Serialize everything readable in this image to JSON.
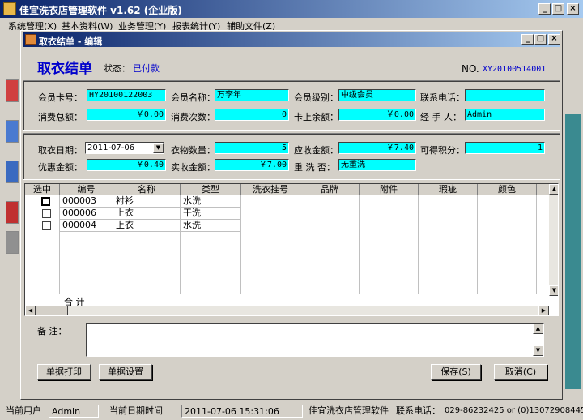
{
  "window": {
    "title": "佳宜洗衣店管理软件 v1.62 (企业版)",
    "minimize": "_",
    "restore": "□",
    "close": "×"
  },
  "menu": [
    "系统管理(X)",
    "基本资料(W)",
    "业务管理(Y)",
    "报表统计(Y)",
    "辅助文件(Z)"
  ],
  "dialog": {
    "title": "取衣结单 - 编辑",
    "minimize": "_",
    "restore": "□",
    "close": "×"
  },
  "form": {
    "title": "取衣结单",
    "status_label": "状态：",
    "status_value": "已付款",
    "no_label": "NO.",
    "no_value": "XY20100514001"
  },
  "member": {
    "card_label": "会员卡号：",
    "card_value": "HY20100122003",
    "name_label": "会员名称：",
    "name_value": "万李年",
    "level_label": "会员级别：",
    "level_value": "中级会员",
    "phone_label": "联系电话：",
    "phone_value": "",
    "total_label": "消费总额：",
    "total_value": "￥0.00",
    "count_label": "消费次数：",
    "count_value": "0",
    "balance_label": "卡上余额：",
    "balance_value": "￥0.00",
    "operator_label": "经 手 人：",
    "operator_value": "Admin"
  },
  "order": {
    "date_label": "取衣日期：",
    "date_value": "2011-07-06",
    "qty_label": "衣物数量：",
    "qty_value": "5",
    "due_label": "应收金额：",
    "due_value": "￥7.40",
    "points_label": "可得积分：",
    "points_value": "1",
    "discount_label": "优惠金额：",
    "discount_value": "￥0.40",
    "paid_label": "实收金额：",
    "paid_value": "￥7.00",
    "rewash_label": "重 洗 否：",
    "rewash_value": "无重洗"
  },
  "grid": {
    "columns": [
      "选中",
      "编号",
      "名称",
      "类型",
      "洗衣挂号",
      "品牌",
      "附件",
      "瑕疵",
      "颜色"
    ],
    "rows": [
      {
        "id": "000003",
        "name": "衬衫",
        "type": "水洗"
      },
      {
        "id": "000006",
        "name": "上衣",
        "type": "干洗"
      },
      {
        "id": "000004",
        "name": "上衣",
        "type": "水洗"
      }
    ],
    "total_label": "合  计"
  },
  "remark_label": "备    注：",
  "buttons": {
    "print": "单据打印",
    "settings": "单据设置",
    "save": "保存(S)",
    "cancel": "取消(C)"
  },
  "statusbar": {
    "user_label": "当前用户",
    "user_value": "Admin",
    "datetime_label": "当前日期时间",
    "datetime_value": "2011-07-06 15:31:06",
    "app_name": "佳宜洗衣店管理软件",
    "phone_label": "联系电话：",
    "phone_value": "029-86232425 or (0)13072908445"
  }
}
